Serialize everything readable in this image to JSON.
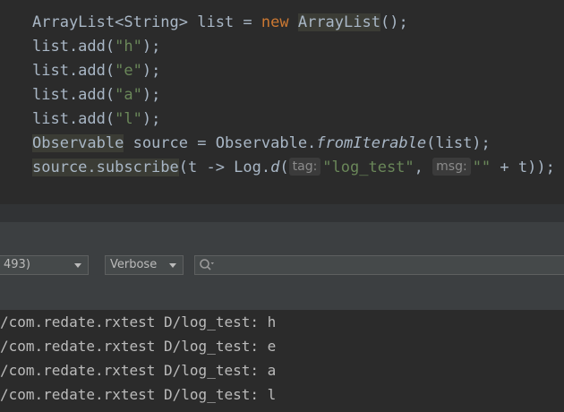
{
  "editor": {
    "line1": {
      "decl": "ArrayList<String> list = ",
      "new_kw": "new",
      "cls": "ArrayList",
      "tail": "();"
    },
    "add_lines": [
      {
        "pre": "list.add(",
        "arg": "\"h\"",
        "post": ");"
      },
      {
        "pre": "list.add(",
        "arg": "\"e\"",
        "post": ");"
      },
      {
        "pre": "list.add(",
        "arg": "\"a\"",
        "post": ");"
      },
      {
        "pre": "list.add(",
        "arg": "\"l\"",
        "post": ");"
      }
    ],
    "line6": {
      "type": "Observable",
      "mid": " source = Observable.",
      "method": "fromIterable",
      "tail": "(list);"
    },
    "line7": {
      "call": "source.subscribe",
      "mid": "(t -> Log.",
      "method": "d",
      "open": "(",
      "hint_tag": "tag:",
      "tag_value": "\"log_test\"",
      "comma": ", ",
      "hint_msg": "msg:",
      "msg_value": "\"\"",
      "tail": " + t));"
    }
  },
  "logcat": {
    "process_filter": "493)",
    "level_filter": "Verbose",
    "search": {
      "value": "",
      "placeholder": ""
    },
    "lines": [
      "/com.redate.rxtest D/log_test: h",
      "/com.redate.rxtest D/log_test: e",
      "/com.redate.rxtest D/log_test: a",
      "/com.redate.rxtest D/log_test: l"
    ]
  }
}
